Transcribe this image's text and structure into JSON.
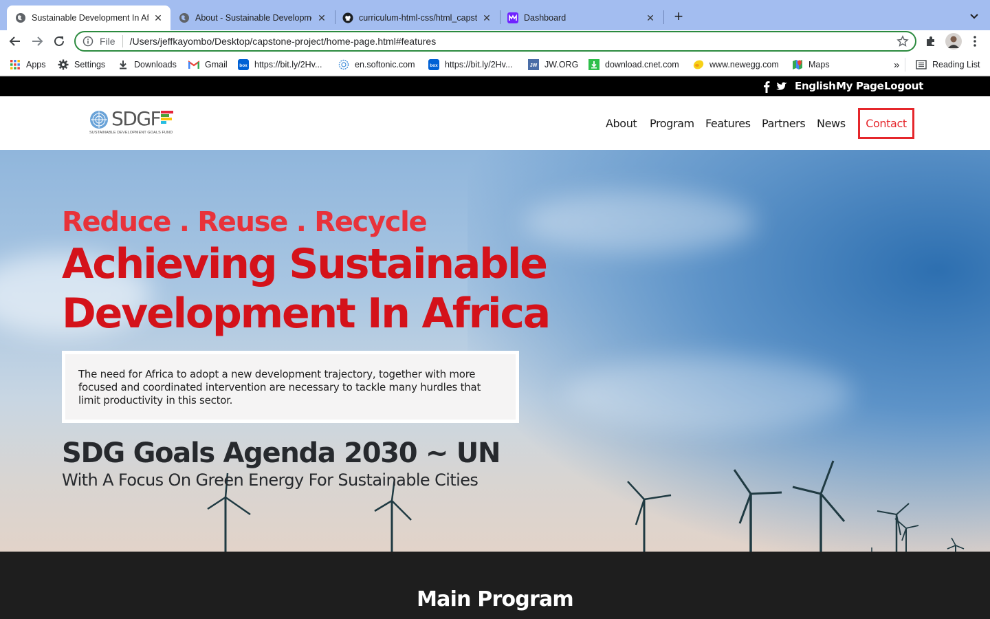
{
  "browser": {
    "tabs": [
      {
        "title": "Sustainable Development In Af",
        "icon": "globe-icon",
        "active": true
      },
      {
        "title": "About - Sustainable Developme",
        "icon": "globe-icon",
        "active": false
      },
      {
        "title": "curriculum-html-css/html_capst",
        "icon": "github-icon",
        "active": false
      },
      {
        "title": "Dashboard",
        "icon": "microverse-icon",
        "active": false
      }
    ],
    "address": {
      "scheme_label": "File",
      "url": "/Users/jeffkayombo/Desktop/capstone-project/home-page.html#features"
    },
    "bookmarks": [
      {
        "label": "Apps",
        "icon": "apps-grid-icon"
      },
      {
        "label": "Settings",
        "icon": "gear-icon"
      },
      {
        "label": "Downloads",
        "icon": "download-icon"
      },
      {
        "label": "Gmail",
        "icon": "gmail-icon"
      },
      {
        "label": "https://bit.ly/2Hv...",
        "icon": "box-icon"
      },
      {
        "label": "en.softonic.com",
        "icon": "softonic-icon"
      },
      {
        "label": "https://bit.ly/2Hv...",
        "icon": "box-icon"
      },
      {
        "label": "JW.ORG",
        "icon": "jw-icon"
      },
      {
        "label": "download.cnet.com",
        "icon": "cnet-download-icon"
      },
      {
        "label": "www.newegg.com",
        "icon": "newegg-icon"
      },
      {
        "label": "Maps",
        "icon": "maps-icon"
      }
    ],
    "overflow_label": "»",
    "reading_list": "Reading List"
  },
  "page": {
    "topbar": {
      "english": "English",
      "mypage": "My Page",
      "logout": "Logout"
    },
    "logo": {
      "word": "SDGF",
      "tagline": "SUSTAINABLE DEVELOPMENT GOALS FUND"
    },
    "nav": [
      "About",
      "Program",
      "Features",
      "Partners",
      "News",
      "Contact"
    ],
    "hero": {
      "eyebrow": "Reduce . Reuse . Recycle",
      "headline_1": "Achieving Sustainable",
      "headline_2": "Development In Africa",
      "description": "The need for Africa to adopt a new development trajectory, together with more focused and coordinated intervention are necessary to tackle many hurdles that limit productivity in this sector.",
      "sdg_title": "SDG Goals Agenda 2030 ~ UN",
      "sdg_subtitle": "With A Focus On Green Energy For Sustainable Cities"
    },
    "program_title": "Main Program"
  },
  "colors": {
    "accent": "#e5262b",
    "headline": "#d4121a",
    "omnibox_border": "#2b8a3e",
    "tabbar": "#a3bdf0"
  }
}
